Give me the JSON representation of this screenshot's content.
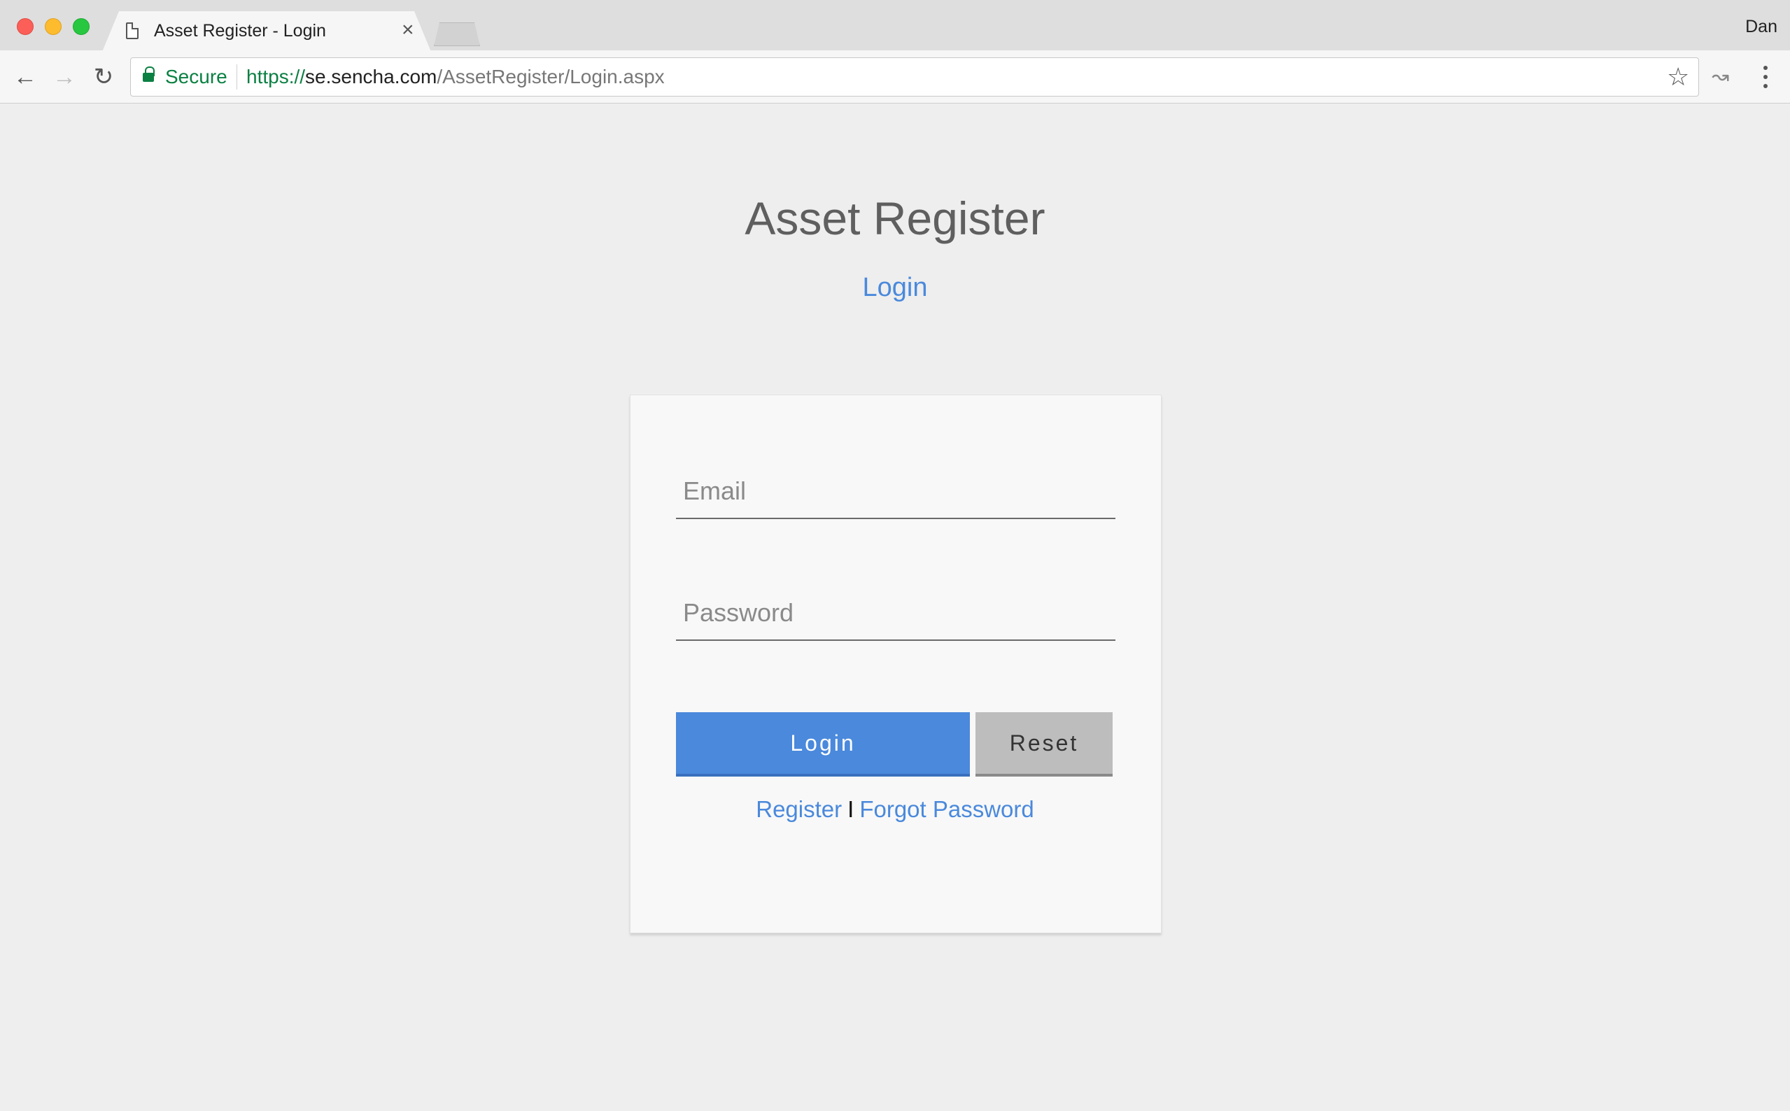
{
  "browser": {
    "tab_title": "Asset Register - Login",
    "tab_close": "×",
    "profile_name": "Dan",
    "secure_label": "Secure",
    "url": {
      "scheme": "https://",
      "host": "se.sencha.com",
      "path": "/AssetRegister/Login.aspx"
    },
    "icons": {
      "back": "arrow-left-icon",
      "forward": "arrow-right-icon",
      "reload": "reload-icon",
      "lock": "lock-icon",
      "bookmark": "star-icon",
      "extension": "extension-icon",
      "menu": "more-vertical-icon"
    }
  },
  "page": {
    "app_title": "Asset Register",
    "subtitle": "Login",
    "form": {
      "email_placeholder": "Email",
      "email_value": "",
      "password_placeholder": "Password",
      "password_value": "",
      "login_label": "Login",
      "reset_label": "Reset"
    },
    "links": {
      "register": "Register",
      "separator": "I",
      "forgot_password": "Forgot Password"
    }
  },
  "colors": {
    "accent": "#4a89dc",
    "secure_green": "#0b8043",
    "reset_gray": "#bdbdbd",
    "page_bg": "#eeeeee",
    "card_bg": "#f8f8f8"
  }
}
